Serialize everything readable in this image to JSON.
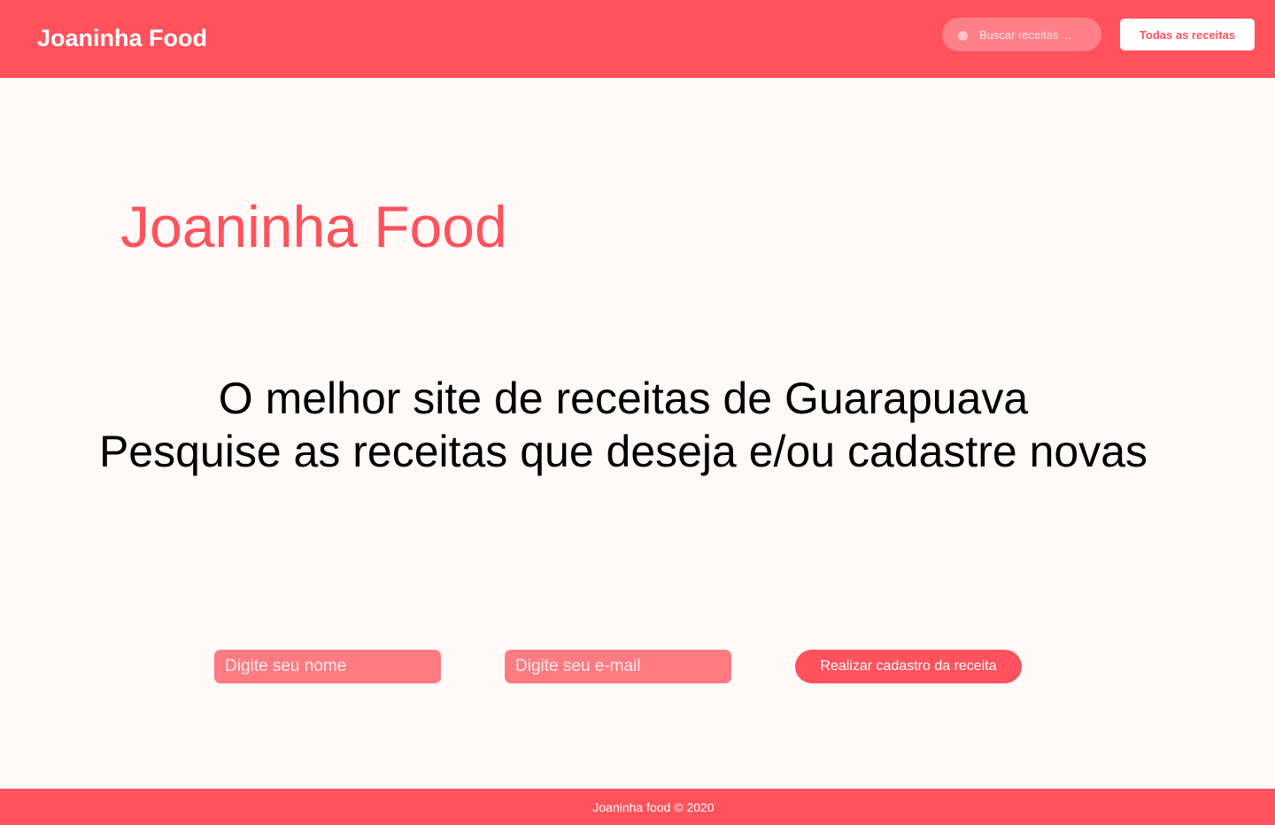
{
  "header": {
    "brand": "Joaninha Food",
    "search_placeholder": "Buscar receitas ...",
    "all_recipes_label": "Todas as receitas"
  },
  "hero": {
    "title": "Joaninha Food",
    "tagline_line1": "O melhor site de receitas de Guarapuava",
    "tagline_line2": "Pesquise as receitas que deseja e/ou cadastre novas"
  },
  "form": {
    "name_placeholder": "Digite seu nome",
    "email_placeholder": "Digite seu e-mail",
    "submit_label": "Realizar cadastro da receita"
  },
  "footer": {
    "text": "Joaninha food © 2020"
  },
  "colors": {
    "brand": "#ff525c",
    "background": "#fff9f8",
    "field": "#ff7a82"
  },
  "icons": {
    "search": "search-icon"
  }
}
